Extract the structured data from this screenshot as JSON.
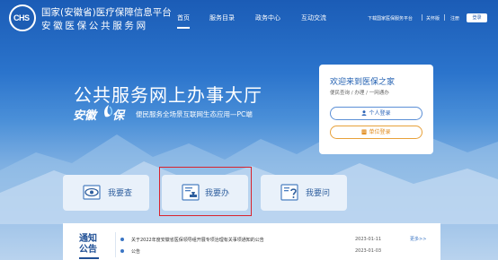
{
  "header": {
    "logo_text": "CHS",
    "title_line1": "国家(安徽省)医疗保障信息平台",
    "title_line2": "安徽医保公共服务网",
    "nav": [
      "首页",
      "服务目录",
      "政务中心",
      "互动交流"
    ],
    "download_label": "下载国家医保服务平台",
    "care_mode_label": "关怀版",
    "register_label": "注册",
    "login_label": "登录"
  },
  "hero": {
    "title": "公共服务网上办事大厅",
    "brand_prefix": "安徽",
    "brand_suffix": "保",
    "slogan": "便民服务全场景互联网生态应用—PC端"
  },
  "welcome": {
    "title": "欢迎来到医保之家",
    "subtitle": "便民查询 / 办理 / 一网通办",
    "personal_login": "个人登录",
    "unit_login": "单位登录"
  },
  "services": [
    {
      "label": "我要查"
    },
    {
      "label": "我要办"
    },
    {
      "label": "我要问"
    }
  ],
  "notice": {
    "title_line1": "通知",
    "title_line2": "公告",
    "items": [
      {
        "text": "关于2022年度安徽省医保领导组开展专项治理有关事项通知的公告",
        "date": "2023-01-11"
      },
      {
        "text": "公告",
        "date": "2023-01-03"
      }
    ],
    "more_label": "更多>>"
  }
}
